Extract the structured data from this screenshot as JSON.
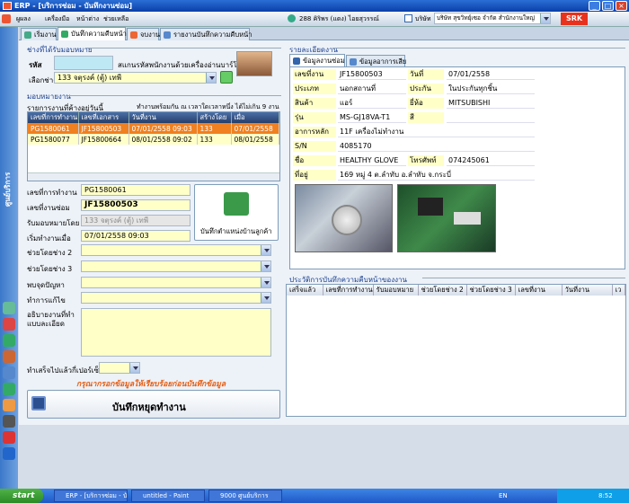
{
  "window": {
    "title": "ERP - [บริการซ่อม - บันทึกงานซ่อม]"
  },
  "menubar": {
    "items": [
      "ผูผลง",
      "เครื่องมือ",
      "หน้าต่าง",
      "ช่วยเหลือ"
    ],
    "users_online": "288 คิริพร (แดง) ไอยสุวรรณ์",
    "branch_label": "บริษัท",
    "branch_value": "บริษัท สุขวิทย์ุเซอ จำกัด สำนักงานใหญ่",
    "logo_text": "SRK"
  },
  "sidebar": {
    "label": "ศูนย์บริการ"
  },
  "tabs": [
    {
      "label": "เริ่มงาน"
    },
    {
      "label": "บันทึกความคืบหน้า"
    },
    {
      "label": "จบงาน"
    },
    {
      "label": "รายงานบันทึกความคืบหน้า"
    }
  ],
  "assignee": {
    "group_title": "ช่างที่ได้รับมอบหมาย",
    "code_label": "รหัส",
    "code_value": "",
    "scan_hint": "สแกนรหัสพนักงานด้วยเครื่องอ่านบาร์โค้ด",
    "tech_label": "เลือกช่าง",
    "tech_value": "133  จตุรงค์ (ตู้) เทพี"
  },
  "assignment": {
    "group_title": "มอบหมายงาน",
    "list_caption": "รายการงานที่ค้างอยู่วันนี้",
    "time_note": "ทำงานพร้อมกัน ณ เวลาใดเวลาหนึ่ง ได้ไม่เกิน 9 งาน",
    "columns": [
      "เลขที่การทำงาน",
      "เลขที่เอกสาร",
      "วันที่งาน",
      "สร้างโดย",
      "เมื่อ"
    ],
    "rows": [
      {
        "job_no": "PG1580061",
        "doc_no": "JF15800503",
        "date": "07/01/2558 09:03",
        "by": "133",
        "when": "07/01/2558",
        "selected": true
      },
      {
        "job_no": "PG1580077",
        "doc_no": "JF15800664",
        "date": "08/01/2558 09:02",
        "by": "133",
        "when": "08/01/2558",
        "selected": false
      }
    ]
  },
  "form": {
    "job_no_label": "เลขที่การทำงาน",
    "job_no": "PG1580061",
    "repair_no_label": "เลขที่งานซ่อม",
    "repair_no": "JF15800503",
    "assigned_by_label": "รับมอบหมายโดย",
    "assigned_by": "133  จตุรงค์ (ตู้) เทพี",
    "start_label": "เริ่มทำงานเมื่อ",
    "start": "07/01/2558 09:03",
    "helper2_label": "ช่วยโดยช่าง 2",
    "helper3_label": "ช่วยโดยช่าง 3",
    "problem_label": "พบจุดปัญหา",
    "fix_label": "ทำการแก้ไข",
    "desc_label": "อธิบายงานที่ทำแบบละเอียด",
    "percent_label": "ทำเสร็จไปแล้วกี่เปอร์เซ็น",
    "warning": "กรุณากรอกข้อมูลให้เรียบร้อยก่อนบันทึกข้อมูล",
    "save_stop_label": "บันทึกหยุดทำงาน",
    "save_location_label": "บันทึกตำแหน่งบ้านลูกค้า"
  },
  "details": {
    "group_title": "รายละเอียดงาน",
    "tab_repair": "ข้อมูลงานซ่อม",
    "tab_expense": "ข้อมูลอาการเสีย",
    "rows": [
      {
        "l1": "เลขที่งาน",
        "v1": "JF15800503",
        "l2": "วันที่",
        "v2": "07/01/2558"
      },
      {
        "l1": "ประเภท",
        "v1": "นอกสถานที่",
        "l2": "ประกัน",
        "v2": "ในประกันทุกชิ้น"
      },
      {
        "l1": "สินค้า",
        "v1": "แอร์",
        "l2": "ยี่ห้อ",
        "v2": "MITSUBISHI"
      },
      {
        "l1": "รุ่น",
        "v1": "MS-GJ18VA-T1",
        "l2": "สี",
        "v2": ""
      }
    ],
    "symptom_label": "อาการหลัก",
    "symptom": "11F เครื่องไม่ทำงาน",
    "sn_label": "S/N",
    "sn": "4085170",
    "name_label": "ชื่อ",
    "name": "HEALTHY GLOVE",
    "phone_label": "โทรศัพท์",
    "phone": "074245061",
    "address_label": "ที่อยู่",
    "address": "169 หมู่ 4 ต.ลำทับ อ.ลำทับ จ.กระบี่"
  },
  "history": {
    "group_title": "ประวัติการบันทึกความคืบหน้าของงาน",
    "columns": [
      "เสร็จแล้ว",
      "เลขที่การทำงาน",
      "รับมอบหมาย",
      "ช่วยโดยช่าง 2",
      "ช่วยโดยช่าง 3",
      "เลขที่งาน",
      "วันที่งาน",
      "เว"
    ]
  },
  "taskbar": {
    "start": "start",
    "buttons": [
      "ERP - [บริการซ่อม - บั...",
      "untitled - Paint",
      "9000 ศูนย์บริการ"
    ],
    "lang": "EN",
    "clock": "8:52"
  },
  "colors": {
    "accent": "#f08020",
    "field": "#ffffc8",
    "titlebar": "#0a3fa8"
  }
}
